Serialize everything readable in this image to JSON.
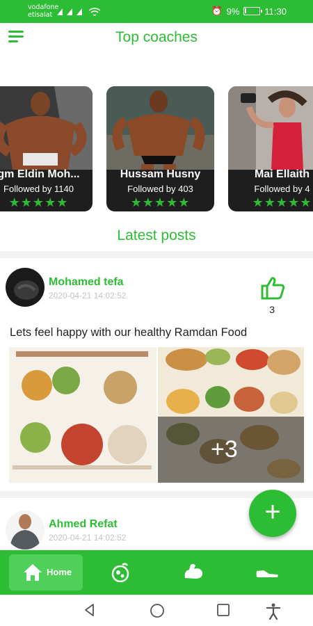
{
  "status_bar": {
    "carrier_1": "vodafone",
    "carrier_2": "etisalat",
    "battery": "9%",
    "time": "11:30"
  },
  "header": {
    "menu_icon": "hamburger-menu-icon",
    "coaches_title": "Top coaches",
    "posts_title": "Latest posts"
  },
  "coaches": [
    {
      "name": "gm Eldin Moh...",
      "followers_text": "Followed by  1140",
      "rating": 5
    },
    {
      "name": "Hussam Husny",
      "followers_text": "Followed by  403",
      "rating": 5
    },
    {
      "name": "Mai Ellaith",
      "followers_text": "Followed by  4",
      "rating": 5
    }
  ],
  "posts": [
    {
      "author": "Mohamed tefa",
      "date": "2020-04-21 14:02:52",
      "likes": "3",
      "text": "Lets feel happy with our healthy Ramdan Food",
      "extra_images": "+3"
    },
    {
      "author": "Ahmed Refat",
      "date": "2020-04-21 14:02:52"
    }
  ],
  "fab": {
    "label": "+"
  },
  "bottom_nav": {
    "items": [
      {
        "label": "Home",
        "icon": "home-icon",
        "active": true
      },
      {
        "label": "",
        "icon": "diet-plate-icon"
      },
      {
        "label": "",
        "icon": "muscle-arm-icon"
      },
      {
        "label": "",
        "icon": "shoe-icon"
      }
    ]
  },
  "colors": {
    "accent": "#2dbd35",
    "nav_active": "#4fd058",
    "text": "#222222",
    "muted": "#c4c4c4"
  }
}
